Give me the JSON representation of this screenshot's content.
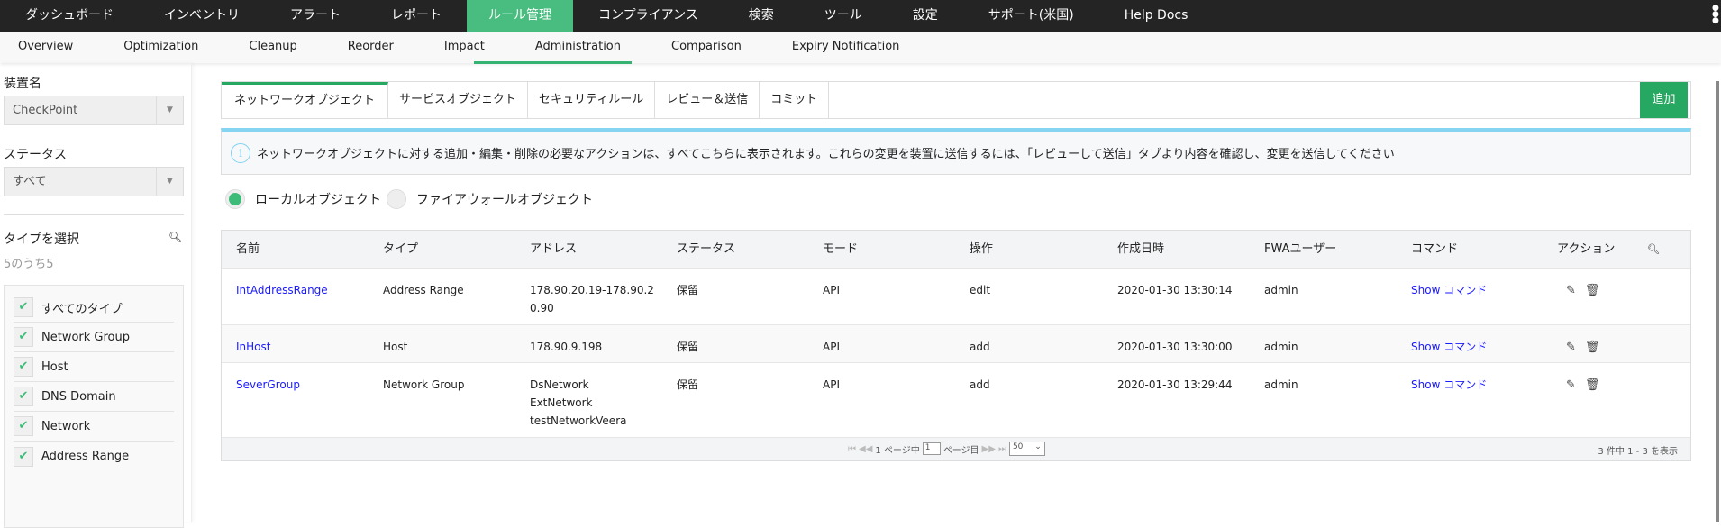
{
  "topnav": [
    "ダッシュボード",
    "インベントリ",
    "アラート",
    "レポート",
    "ルール管理",
    "コンプライアンス",
    "検索",
    "ツール",
    "設定",
    "サポート(米国)",
    "Help Docs"
  ],
  "subnav": [
    "Overview",
    "Optimization",
    "Cleanup",
    "Reorder",
    "Impact",
    "Administration",
    "Comparison",
    "Expiry Notification"
  ],
  "sidebar": {
    "device_label": "装置名",
    "device_value": "CheckPoint",
    "status_label": "ステータス",
    "status_value": "すべて",
    "type_label": "タイプを選択",
    "type_count": "5のうち5",
    "types": [
      "すべてのタイプ",
      "Network Group",
      "Host",
      "DNS Domain",
      "Network",
      "Address Range"
    ]
  },
  "tabs": [
    "ネットワークオブジェクト",
    "サービスオブジェクト",
    "セキュリティルール",
    "レビュー＆送信",
    "コミット"
  ],
  "add_label": "追加",
  "info_icon": "i",
  "info": "ネットワークオブジェクトに対する追加・編集・削除の必要なアクションは、すべてこちらに表示されます。これらの変更を装置に送信するには、「レビューして送信」タブより内容を確認し、変更を送信してください",
  "radios": [
    "ローカルオブジェクト",
    "ファイアウォールオブジェクト"
  ],
  "table": {
    "headers": [
      "名前",
      "タイプ",
      "アドレス",
      "ステータス",
      "モード",
      "操作",
      "作成日時",
      "FWAユーザー",
      "コマンド",
      "アクション"
    ],
    "rows": [
      {
        "name": "IntAddressRange",
        "type": "Address Range",
        "address": [
          "178.90.20.19-178.90.2",
          "0.90"
        ],
        "status": "保留",
        "mode": "API",
        "op": "edit",
        "created": "2020-01-30 13:30:14",
        "user": "admin",
        "command": "Show コマンド"
      },
      {
        "name": "InHost",
        "type": "Host",
        "address": [
          "178.90.9.198"
        ],
        "status": "保留",
        "mode": "API",
        "op": "add",
        "created": "2020-01-30 13:30:00",
        "user": "admin",
        "command": "Show コマンド"
      },
      {
        "name": "SeverGroup",
        "type": "Network Group",
        "address": [
          "DsNetwork",
          "ExtNetwork",
          "testNetworkVeera"
        ],
        "status": "保留",
        "mode": "API",
        "op": "add",
        "created": "2020-01-30 13:29:44",
        "user": "admin",
        "command": "Show コマンド"
      }
    ]
  },
  "pager": {
    "page_of": "1 ページ中",
    "page": "1",
    "page_suffix": "ページ目",
    "page_size": "50",
    "count": "3 件中 1 - 3 を表示"
  },
  "colors": {
    "accent": "#27a862",
    "nav": "#242424",
    "link": "#1a1aff"
  }
}
